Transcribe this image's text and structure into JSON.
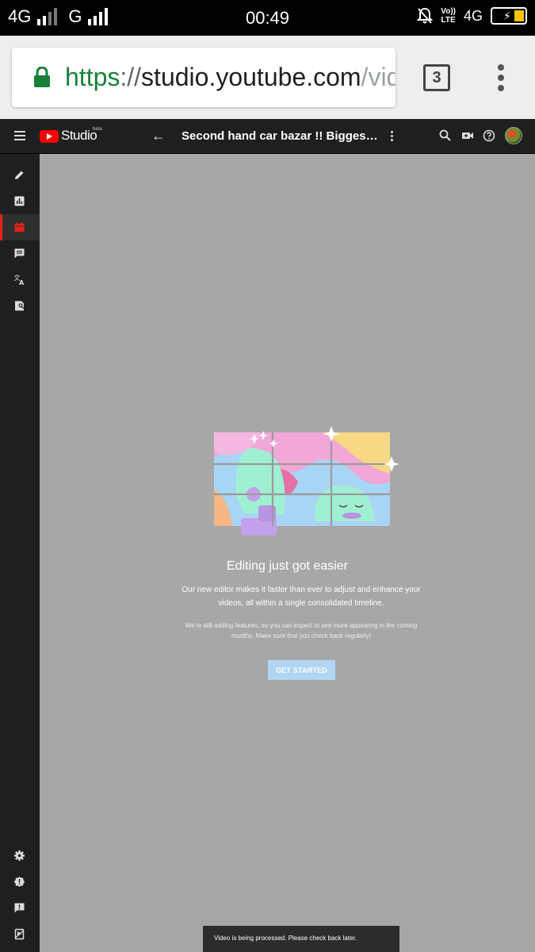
{
  "status_bar": {
    "network_1": "4G",
    "network_2": "G",
    "time": "00:49",
    "volte_top": "Vo))",
    "volte_bottom": "LTE",
    "network_3": "4G"
  },
  "browser": {
    "url_scheme": "https",
    "url_separator": "://",
    "url_host": "studio.youtube.com",
    "url_rest": "/vid",
    "tab_count": "3"
  },
  "header": {
    "logo_text": "Studio",
    "beta_label": "beta",
    "video_title": "Second hand car bazar !! Biggest Car Market"
  },
  "sidebar": {
    "items": [
      {
        "icon": "pencil-icon",
        "name": "details"
      },
      {
        "icon": "analytics-icon",
        "name": "analytics"
      },
      {
        "icon": "editor-icon",
        "name": "editor",
        "active": true
      },
      {
        "icon": "comments-icon",
        "name": "comments"
      },
      {
        "icon": "translate-icon",
        "name": "translations"
      },
      {
        "icon": "copyright-icon",
        "name": "copyright"
      }
    ],
    "bottom_items": [
      {
        "icon": "gear-icon"
      },
      {
        "icon": "alert-icon"
      },
      {
        "icon": "feedback-icon"
      },
      {
        "icon": "creator-studio-icon"
      }
    ]
  },
  "main": {
    "title": "Editing just got easier",
    "body": "Our new editor makes it faster than ever to adjust and enhance your videos, all within a single consolidated timeline.",
    "note": "We're still adding features, so you can expect to see more appearing in the coming months. Make sure that you check back regularly!",
    "cta_label": "GET STARTED"
  },
  "toast": {
    "message": "Video is being processed. Please check back later."
  },
  "colors": {
    "accent_red": "#e62117",
    "main_bg": "#a7a7a7",
    "header_bg": "#1f1f1f",
    "button_bg": "#b1d6f3",
    "url_scheme_green": "#188038",
    "battery": "#f5c400"
  }
}
